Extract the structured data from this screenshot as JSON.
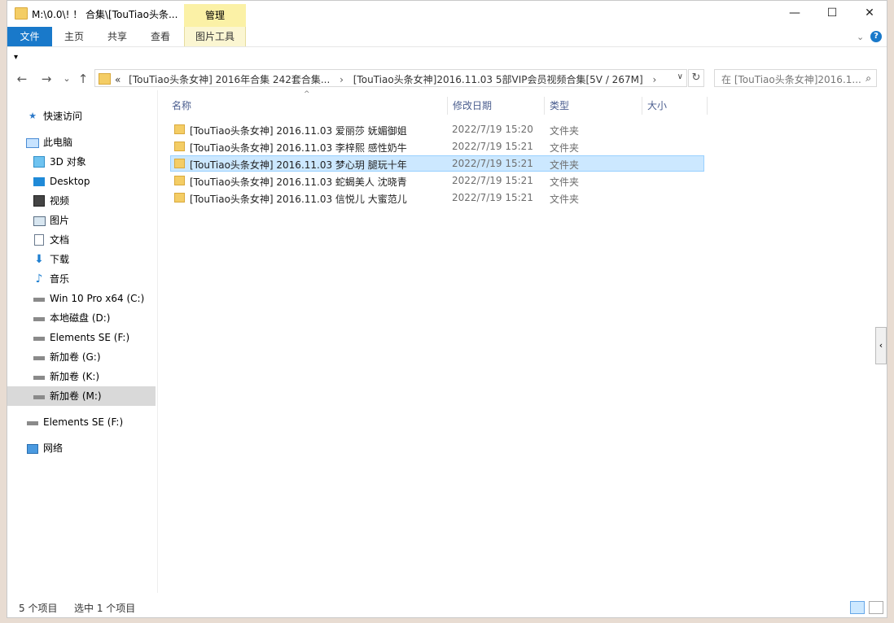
{
  "window": {
    "title": "M:\\0.0\\! ！ 合集\\[TouTiao头条...",
    "manage_tab": "管理",
    "controls": {
      "minimize": "—",
      "maximize": "☐",
      "close": "✕"
    }
  },
  "ribbon": {
    "tabs": [
      "文件",
      "主页",
      "共享",
      "查看",
      "图片工具"
    ],
    "expand_icon": "chevron-down-icon",
    "help": "?"
  },
  "quick_access_toolbar": "▾",
  "navigation": {
    "back": "←",
    "forward": "→",
    "recent": "⌄",
    "up": "↑",
    "address_prefix": "«",
    "breadcrumb": [
      "[TouTiao头条女神] 2016年合集 242套合集...",
      "[TouTiao头条女神]2016.11.03 5部VIP会员视频合集[5V / 267M]"
    ],
    "refresh": "↻",
    "search_placeholder": "在 [TouTiao头条女神]2016.1..."
  },
  "sidebar": {
    "items": [
      {
        "label": "快速访问",
        "icon": "star-icon"
      },
      {
        "label": "此电脑",
        "icon": "computer-icon"
      },
      {
        "label": "3D 对象",
        "icon": "cube-icon"
      },
      {
        "label": "Desktop",
        "icon": "desktop-icon"
      },
      {
        "label": "视频",
        "icon": "video-icon"
      },
      {
        "label": "图片",
        "icon": "picture-icon"
      },
      {
        "label": "文档",
        "icon": "document-icon"
      },
      {
        "label": "下载",
        "icon": "download-icon"
      },
      {
        "label": "音乐",
        "icon": "music-icon"
      },
      {
        "label": "Win 10 Pro x64 (C:)",
        "icon": "system-drive-icon"
      },
      {
        "label": "本地磁盘 (D:)",
        "icon": "drive-icon"
      },
      {
        "label": "Elements SE (F:)",
        "icon": "drive-icon"
      },
      {
        "label": "新加卷 (G:)",
        "icon": "drive-icon"
      },
      {
        "label": "新加卷 (K:)",
        "icon": "drive-icon"
      },
      {
        "label": "新加卷 (M:)",
        "icon": "drive-icon"
      },
      {
        "label": "Elements SE (F:)",
        "icon": "drive-icon"
      },
      {
        "label": "网络",
        "icon": "network-icon"
      }
    ],
    "selected": "新加卷 (M:)"
  },
  "columns": [
    "名称",
    "修改日期",
    "类型",
    "大小"
  ],
  "files": [
    {
      "name": "[TouTiao头条女神] 2016.11.03 爱丽莎 妩媚御姐",
      "date": "2022/7/19 15:20",
      "type": "文件夹"
    },
    {
      "name": "[TouTiao头条女神] 2016.11.03 李梓熙 感性奶牛",
      "date": "2022/7/19 15:21",
      "type": "文件夹"
    },
    {
      "name": "[TouTiao头条女神] 2016.11.03 梦心玥 腿玩十年",
      "date": "2022/7/19 15:21",
      "type": "文件夹"
    },
    {
      "name": "[TouTiao头条女神] 2016.11.03 蛇蝎美人 沈晓青",
      "date": "2022/7/19 15:21",
      "type": "文件夹"
    },
    {
      "name": "[TouTiao头条女神] 2016.11.03 信悦儿 大蜜范儿",
      "date": "2022/7/19 15:21",
      "type": "文件夹"
    }
  ],
  "selected_file": "[TouTiao头条女神] 2016.11.03 梦心玥 腿玩十年",
  "status": {
    "item_count": "5 个项目",
    "selected_count": "选中 1 个项目"
  },
  "colors": {
    "file_tab": "#1979ca",
    "manage_tab": "#fbf1a6",
    "selection": "#cce8ff",
    "folder": "#f4cd65"
  }
}
